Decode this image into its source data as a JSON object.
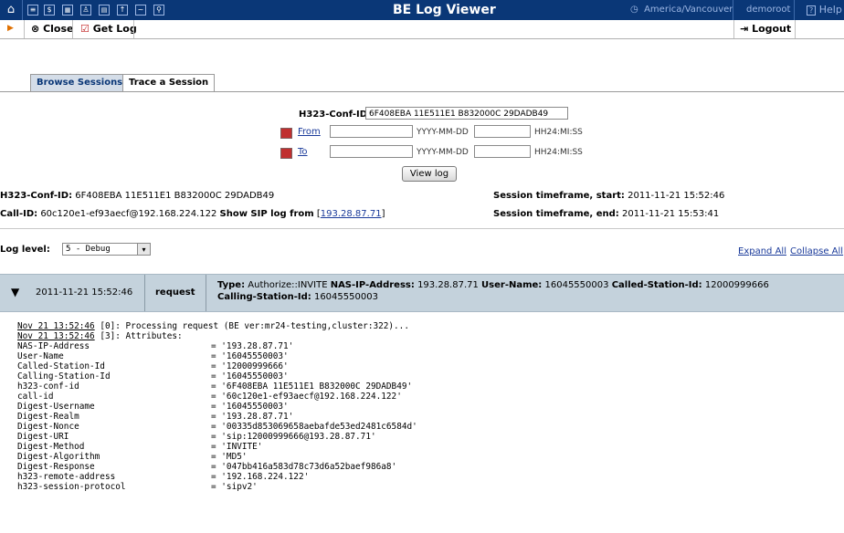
{
  "app": {
    "title": "BE Log Viewer",
    "timezone": "America/Vancouver",
    "username": "demoroot",
    "help_label": "Help"
  },
  "toolbar": {
    "close_label": "Close",
    "getlog_label": "Get Log",
    "logout_label": "Logout"
  },
  "tabs": [
    {
      "label": "Browse Sessions",
      "active": false
    },
    {
      "label": "Trace a Session",
      "active": true
    }
  ],
  "form": {
    "conf_id_label": "H323-Conf-ID",
    "conf_id_value": "6F408EBA 11E511E1 B832000C 29DADB49",
    "from_label": "From",
    "to_label": "To",
    "date_hint": "YYYY-MM-DD",
    "time_hint": "HH24:MI:SS",
    "view_button": "View log"
  },
  "session": {
    "conf_id_label": "H323-Conf-ID:",
    "conf_id_value": "6F408EBA 11E511E1 B832000C 29DADB49",
    "call_id_label": "Call-ID:",
    "call_id_value": "60c120e1-ef93aecf@192.168.224.122",
    "sip_log_label": "Show SIP log from",
    "sip_log_ip": "193.28.87.71",
    "start_label": "Session timeframe, start:",
    "start_value": "2011-11-21 15:52:46",
    "end_label": "Session timeframe, end:",
    "end_value": "2011-11-21 15:53:41"
  },
  "loglevel": {
    "label": "Log level:",
    "value": "5 - Debug",
    "expand_all": "Expand All",
    "collapse_all": "Collapse All"
  },
  "request": {
    "timestamp": "2011-11-21 15:52:46",
    "kind": "request",
    "type_label": "Type:",
    "type_value": "Authorize::INVITE",
    "nas_label": "NAS-IP-Address:",
    "nas_value": "193.28.87.71",
    "user_label": "User-Name:",
    "user_value": "16045550003",
    "called_label": "Called-Station-Id:",
    "called_value": "12000999666",
    "calling_label": "Calling-Station-Id:",
    "calling_value": "16045550003"
  },
  "log": {
    "line1_ts": "Nov 21 13:52:46",
    "line1_text": " [0]: Processing request (BE ver:mr24-testing,cluster:322)...",
    "line2_ts": "Nov 21 13:52:46",
    "line2_text": " [3]: Attributes:",
    "attributes": [
      {
        "k": "NAS-IP-Address",
        "v": "= '193.28.87.71'"
      },
      {
        "k": "User-Name",
        "v": "= '16045550003'"
      },
      {
        "k": "Called-Station-Id",
        "v": "= '12000999666'"
      },
      {
        "k": "Calling-Station-Id",
        "v": "= '16045550003'"
      },
      {
        "k": "h323-conf-id",
        "v": "= '6F408EBA 11E511E1 B832000C 29DADB49'"
      },
      {
        "k": "call-id",
        "v": "= '60c120e1-ef93aecf@192.168.224.122'"
      },
      {
        "k": "Digest-Username",
        "v": "= '16045550003'"
      },
      {
        "k": "Digest-Realm",
        "v": "= '193.28.87.71'"
      },
      {
        "k": "Digest-Nonce",
        "v": "= '00335d853069658aebafde53ed2481c6584d'"
      },
      {
        "k": "Digest-URI",
        "v": "= 'sip:12000999666@193.28.87.71'"
      },
      {
        "k": "Digest-Method",
        "v": "= 'INVITE'"
      },
      {
        "k": "Digest-Algorithm",
        "v": "= 'MD5'"
      },
      {
        "k": "Digest-Response",
        "v": "= '047bb416a583d78c73d6a52baef986a8'"
      },
      {
        "k": "h323-remote-address",
        "v": "= '192.168.224.122'"
      },
      {
        "k": "h323-session-protocol",
        "v": "= 'sipv2'"
      }
    ]
  },
  "icons": [
    "home-icon",
    "list-icon",
    "dollar-icon",
    "grid-icon",
    "person-icon",
    "calculator-icon",
    "upload-icon",
    "chart-icon",
    "search-icon"
  ]
}
